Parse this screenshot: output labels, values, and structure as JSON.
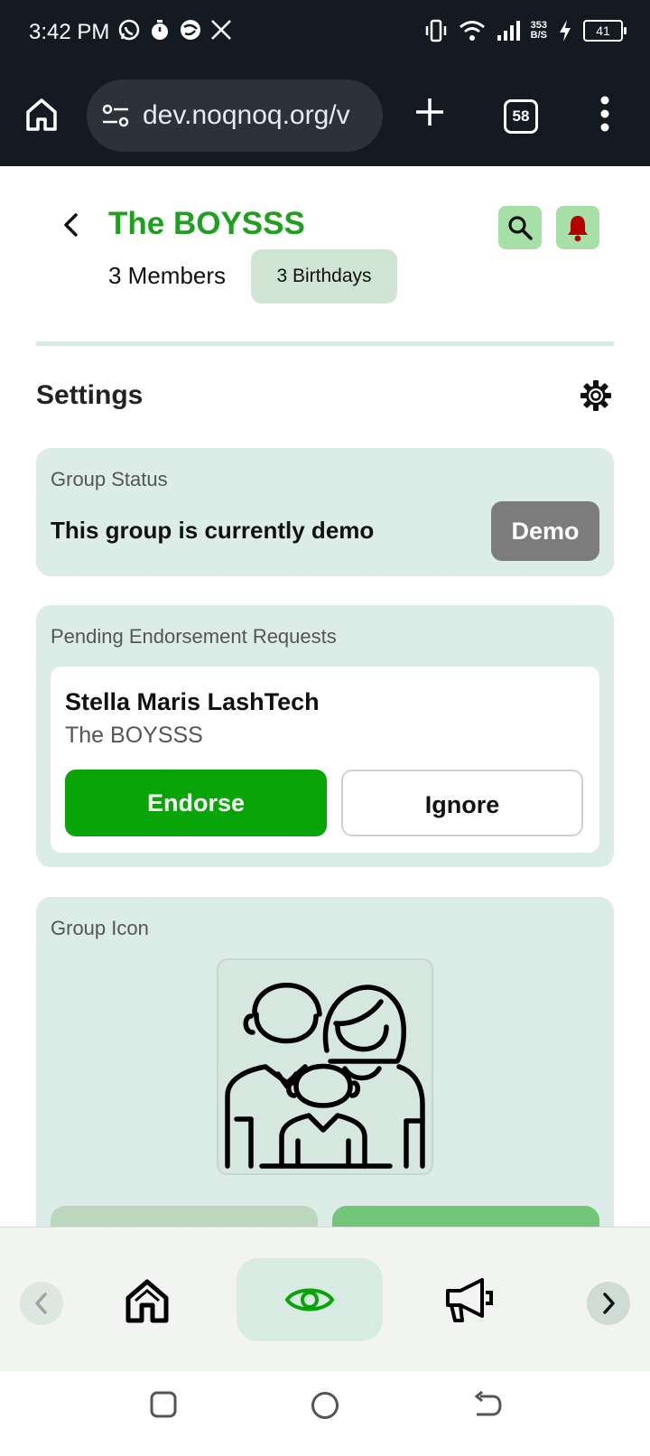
{
  "status_bar": {
    "time": "3:42 PM",
    "net_speed_value": "353",
    "net_speed_unit": "B/S",
    "battery": "41",
    "app_icons": [
      "whatsapp-icon",
      "timer-icon",
      "vpn-icon",
      "x-icon"
    ]
  },
  "browser": {
    "url": "dev.noqnoq.org/v",
    "tab_count": "58"
  },
  "header": {
    "title": "The BOYSSS",
    "members": "3 Members",
    "birthdays": "3 Birthdays"
  },
  "settings": {
    "title": "Settings"
  },
  "group_status": {
    "label": "Group Status",
    "text": "This group is currently demo",
    "badge": "Demo"
  },
  "pending": {
    "label": "Pending Endorsement Requests",
    "requests": [
      {
        "name": "Stella Maris LashTech",
        "group": "The BOYSSS",
        "endorse_label": "Endorse",
        "ignore_label": "Ignore"
      }
    ]
  },
  "group_icon": {
    "label": "Group Icon",
    "icon": "family-icon"
  },
  "colors": {
    "title_green": "#1ea01e",
    "endorse_green": "#08a408",
    "card_bg": "#dcece6",
    "bell_red": "#b30000",
    "status_bar_bg": "#141a22"
  }
}
